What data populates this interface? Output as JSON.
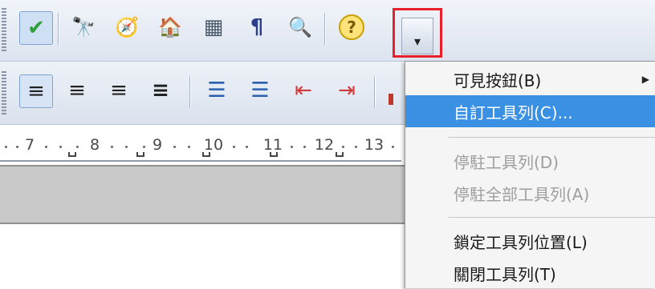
{
  "toolbar_top": {
    "buttons": [
      {
        "icon": "spellcheck-icon",
        "glyph": "✔",
        "color": "#2f9e3a",
        "pressed": true
      },
      {
        "icon": "find-binoculars-icon",
        "glyph": "🔭",
        "color": "#333333"
      },
      {
        "icon": "navigator-compass-icon",
        "glyph": "🧭",
        "color": "#7a4fcf"
      },
      {
        "icon": "gallery-icon",
        "glyph": "🏠",
        "color": "#c43a1a"
      },
      {
        "icon": "data-sources-icon",
        "glyph": "▦",
        "color": "#4a5a6a"
      },
      {
        "icon": "formatting-marks-icon",
        "glyph": "¶",
        "color": "#2a3f8a"
      },
      {
        "icon": "zoom-icon",
        "glyph": "🔍",
        "color": "#3a6ea5"
      },
      {
        "icon": "help-icon",
        "glyph": "?",
        "color": "#a07800"
      }
    ],
    "overflow_button_glyph": "▾"
  },
  "toolbar_format": {
    "buttons": [
      {
        "icon": "align-left-icon",
        "glyph": "≡",
        "pressed": true
      },
      {
        "icon": "align-center-icon",
        "glyph": "≡"
      },
      {
        "icon": "align-right-icon",
        "glyph": "≡"
      },
      {
        "icon": "justify-icon",
        "glyph": "≡"
      },
      {
        "icon": "numbering-icon",
        "glyph": "☰"
      },
      {
        "icon": "bullets-icon",
        "glyph": "☰"
      },
      {
        "icon": "decrease-indent-icon",
        "glyph": "⇤"
      },
      {
        "icon": "increase-indent-icon",
        "glyph": "⇥"
      }
    ]
  },
  "ruler": {
    "numbers": [
      "7",
      "8",
      "9",
      "10",
      "11",
      "12",
      "13"
    ]
  },
  "menu": {
    "items": [
      {
        "label": "可見按鈕(B)",
        "state": "normal",
        "submenu": true
      },
      {
        "label": "自訂工具列(C)...",
        "state": "selected"
      },
      {
        "label": "停駐工具列(D)",
        "state": "disabled"
      },
      {
        "label": "停駐全部工具列(A)",
        "state": "disabled"
      },
      {
        "label": "鎖定工具列位置(L)",
        "state": "normal"
      },
      {
        "label": "關閉工具列(T)",
        "state": "normal"
      }
    ]
  },
  "colors": {
    "menu_highlight": "#3a91e3",
    "callout_border": "#e8202a"
  }
}
